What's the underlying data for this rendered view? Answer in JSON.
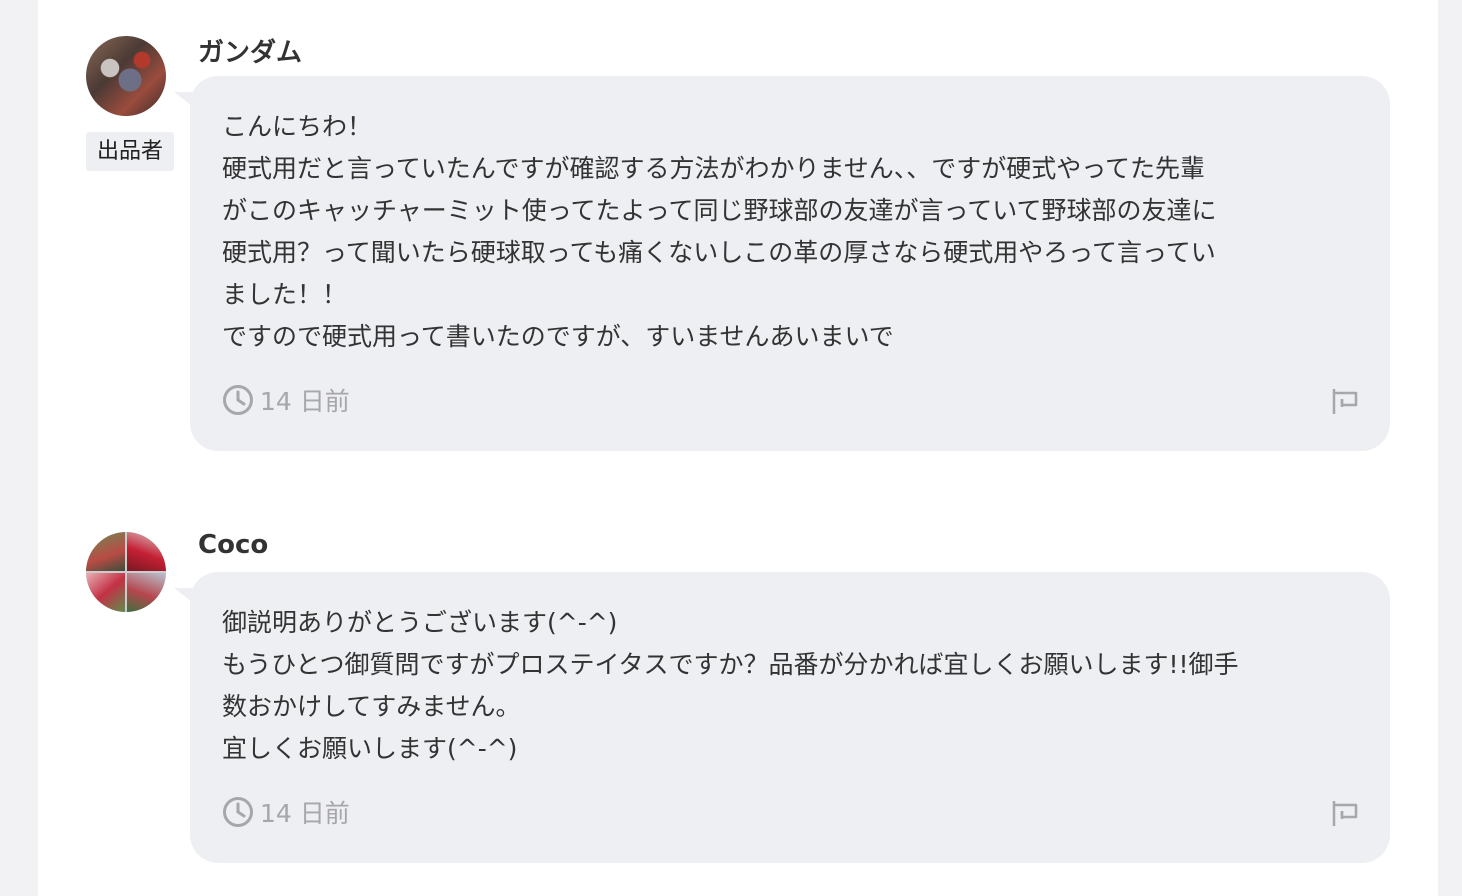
{
  "comments": [
    {
      "user": "ガンダム",
      "badge": "出品者",
      "lines": [
        "こんにちわ！",
        "硬式用だと言っていたんですが確認する方法がわかりません、、ですが硬式やってた先輩",
        "がこのキャッチャーミット使ってたよって同じ野球部の友達が言っていて野球部の友達に",
        "硬式用？って聞いたら硬球取っても痛くないしこの革の厚さなら硬式用やろって言ってい",
        "ました！！",
        "ですので硬式用って書いたのですが、すいませんあいまいで"
      ],
      "time": "14 日前",
      "avatar_icon": "user-photo",
      "time_icon": "clock-icon",
      "report_icon": "flag-icon"
    },
    {
      "user": "Coco",
      "lines": [
        "御説明ありがとうございます(^-^)",
        "もうひとつ御質問ですがプロステイタスですか？品番が分かれば宜しくお願いします!!御手",
        "数おかけしてすみません。",
        "宜しくお願いします(^-^)"
      ],
      "time": "14 日前",
      "avatar_icon": "user-photo",
      "time_icon": "clock-icon",
      "report_icon": "flag-icon"
    }
  ],
  "colors": {
    "background": "#f2f2f4",
    "panel": "#ffffff",
    "bubble": "#eeeff2",
    "text": "#333333",
    "meta": "#a6a6ab"
  }
}
